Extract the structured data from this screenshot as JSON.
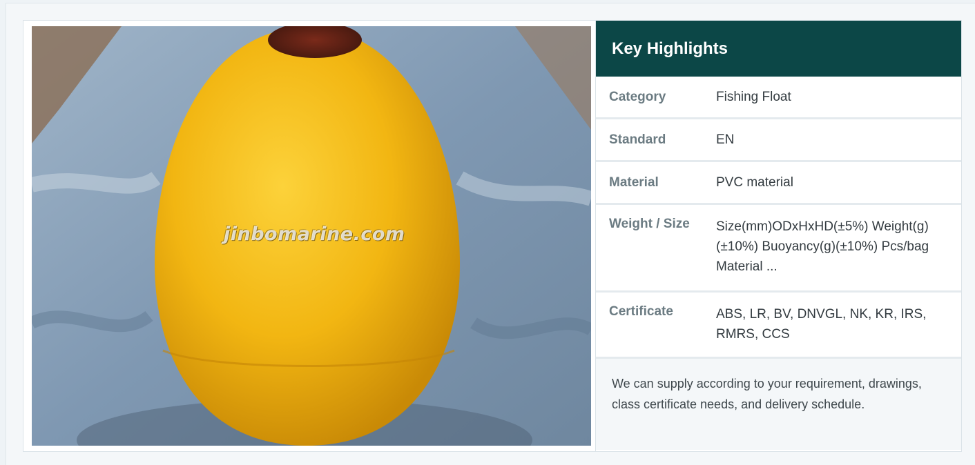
{
  "product_image": {
    "watermark": "jinbomarine.com"
  },
  "highlights": {
    "title": "Key Highlights",
    "rows": [
      {
        "label": "Category",
        "value": "Fishing Float"
      },
      {
        "label": "Standard",
        "value": "EN"
      },
      {
        "label": "Material",
        "value": "PVC material"
      },
      {
        "label": "Weight / Size",
        "value": "Size(mm)ODxHxHD(±5%) Weight(g)(±10%) Buoyancy(g)(±10%) Pcs/bag Material ..."
      },
      {
        "label": "Certificate",
        "value": "ABS, LR, BV, DNVGL, NK, KR, IRS, RMRS, CCS"
      }
    ],
    "note": "We can supply according to your requirement, drawings, class certificate needs, and delivery schedule."
  },
  "colors": {
    "header_bg": "#0c4747",
    "float_yellow": "#f2b612"
  }
}
